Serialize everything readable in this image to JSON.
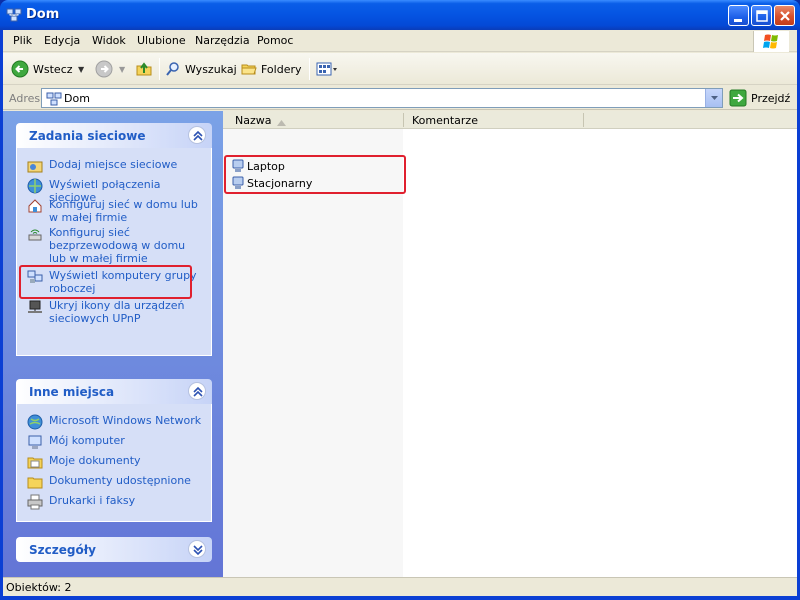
{
  "window": {
    "title": "Dom"
  },
  "menu": [
    "Plik",
    "Edycja",
    "Widok",
    "Ulubione",
    "Narzędzia",
    "Pomoc"
  ],
  "toolbar": {
    "back": "Wstecz",
    "search": "Wyszukaj",
    "folders": "Foldery"
  },
  "address": {
    "label": "Adres",
    "value": "Dom",
    "go": "Przejdź"
  },
  "tasks_panel": {
    "title": "Zadania sieciowe",
    "items": [
      "Dodaj miejsce sieciowe",
      "Wyświetl połączenia sieciowe",
      "Konfiguruj sieć w domu lub w małej firmie",
      "Konfiguruj sieć bezprzewodową w domu lub w małej firmie",
      "Wyświetl komputery grupy roboczej",
      "Ukryj ikony dla urządzeń sieciowych UPnP"
    ]
  },
  "places_panel": {
    "title": "Inne miejsca",
    "items": [
      "Microsoft Windows Network",
      "Mój komputer",
      "Moje dokumenty",
      "Dokumenty udostępnione",
      "Drukarki i faksy"
    ]
  },
  "details_panel": {
    "title": "Szczegóły"
  },
  "columns": [
    "Nazwa",
    "Komentarze"
  ],
  "files": [
    {
      "name": "Laptop"
    },
    {
      "name": "Stacjonarny"
    }
  ],
  "status": {
    "text": "Obiektów: 2"
  },
  "colors": {
    "highlight": "#e0202e",
    "link": "#215dc6",
    "title_bar": "#0554e2"
  }
}
